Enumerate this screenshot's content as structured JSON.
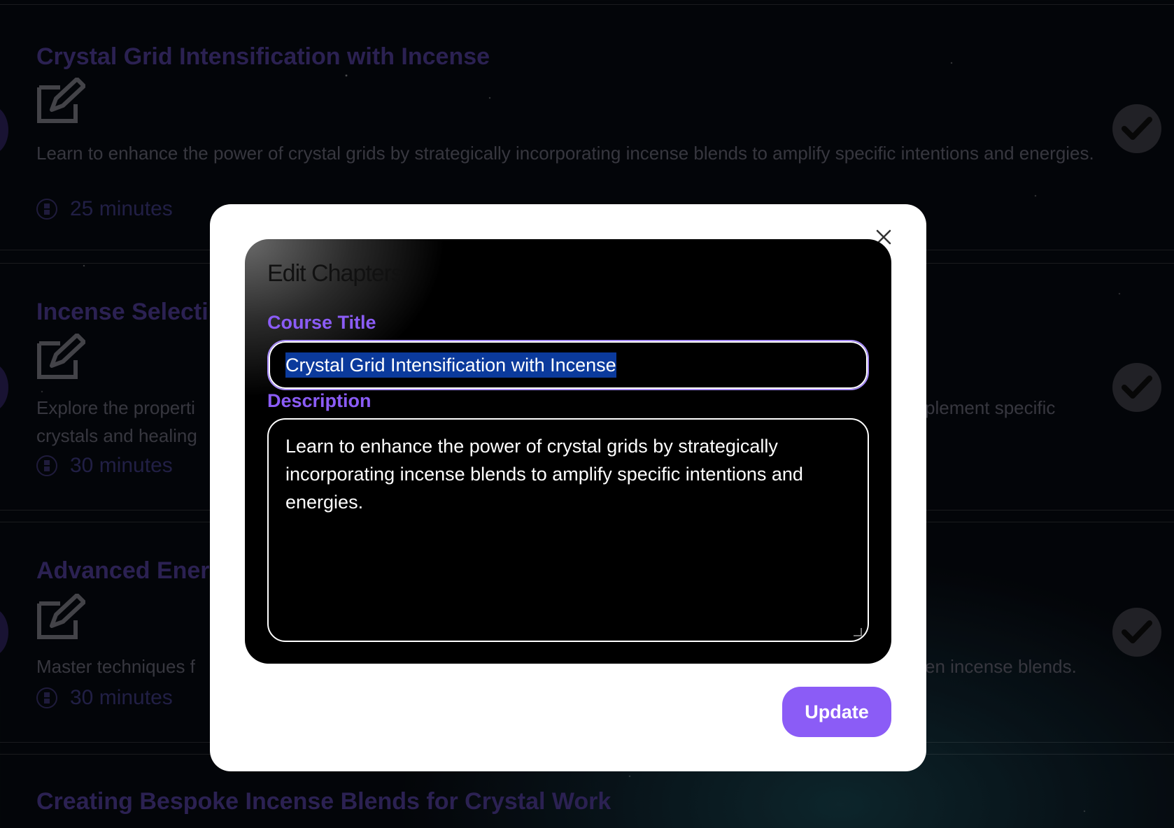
{
  "chapters": [
    {
      "title": "Crystal Grid Intensification with Incense",
      "description": "Learn to enhance the power of crystal grids by strategically incorporating incense blends to amplify specific intentions and energies.",
      "duration": "25 minutes"
    },
    {
      "title": "Incense Selecti",
      "description_left": "Explore the properti",
      "description_left_2": "crystals and healing",
      "description_right": "plement specific",
      "duration": "30 minutes"
    },
    {
      "title": "Advanced Ener",
      "description_left": "Master techniques f",
      "description_right": "en incense blends.",
      "duration": "30 minutes"
    },
    {
      "title": "Creating Bespoke Incense Blends for Crystal Work"
    }
  ],
  "modal": {
    "heading": "Edit Chapters",
    "course_title_label": "Course Title",
    "course_title_value": "Crystal Grid Intensification with Incense",
    "description_label": "Description",
    "description_value": "Learn to enhance the power of crystal grids by strategically incorporating incense blends to amplify specific intentions and energies.",
    "update_label": "Update",
    "close_label": "×"
  },
  "colors": {
    "accent": "#8b5cf6",
    "selection": "#0b3a9c",
    "modal_bg": "#ffffff",
    "panel_bg": "#000000"
  }
}
